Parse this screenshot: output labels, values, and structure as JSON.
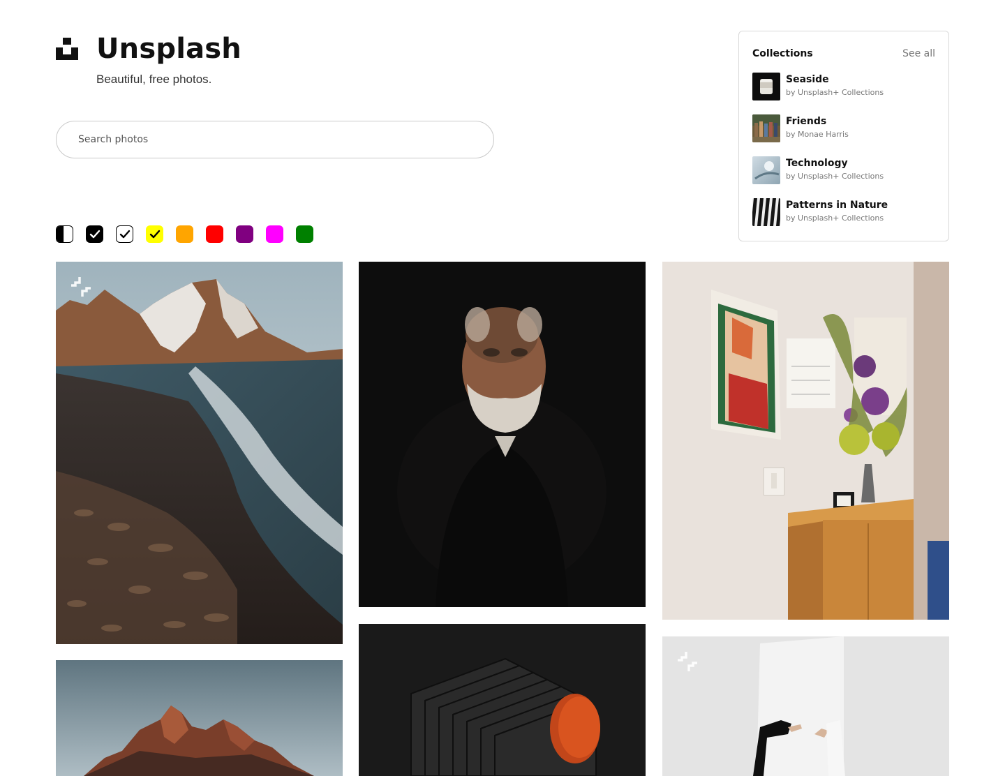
{
  "brand": {
    "title": "Unsplash",
    "tagline": "Beautiful, free photos."
  },
  "search": {
    "placeholder": "Search photos"
  },
  "color_filters": [
    {
      "name": "black-and-white",
      "color": "#000000"
    },
    {
      "name": "black",
      "color": "#000000",
      "checked": true
    },
    {
      "name": "white",
      "color": "#ffffff",
      "checked": true
    },
    {
      "name": "yellow",
      "color": "#ffff00",
      "checked": true
    },
    {
      "name": "orange",
      "color": "#ffa500"
    },
    {
      "name": "red",
      "color": "#ff0000"
    },
    {
      "name": "purple",
      "color": "#800080"
    },
    {
      "name": "magenta",
      "color": "#ff00ff"
    },
    {
      "name": "green",
      "color": "#008000"
    }
  ],
  "collections": {
    "title": "Collections",
    "see_all": "See all",
    "items": [
      {
        "name": "Seaside",
        "by": "by Unsplash+ Collections"
      },
      {
        "name": "Friends",
        "by": "by Monae Harris"
      },
      {
        "name": "Technology",
        "by": "by Unsplash+ Collections"
      },
      {
        "name": "Patterns in Nature",
        "by": "by Unsplash+ Collections"
      }
    ]
  },
  "photos": [
    {
      "name": "mountain-beach-photo",
      "unsplash_plus": true
    },
    {
      "name": "bearded-man-portrait-photo",
      "unsplash_plus": false
    },
    {
      "name": "painting-and-flowers-photo",
      "unsplash_plus": false
    },
    {
      "name": "red-mountain-peak-photo",
      "unsplash_plus": false
    },
    {
      "name": "dark-layered-object-photo",
      "unsplash_plus": false
    },
    {
      "name": "hands-mirror-photo",
      "unsplash_plus": true
    }
  ],
  "colors": {
    "border": "#d9d9d9",
    "muted_text": "#767676"
  }
}
